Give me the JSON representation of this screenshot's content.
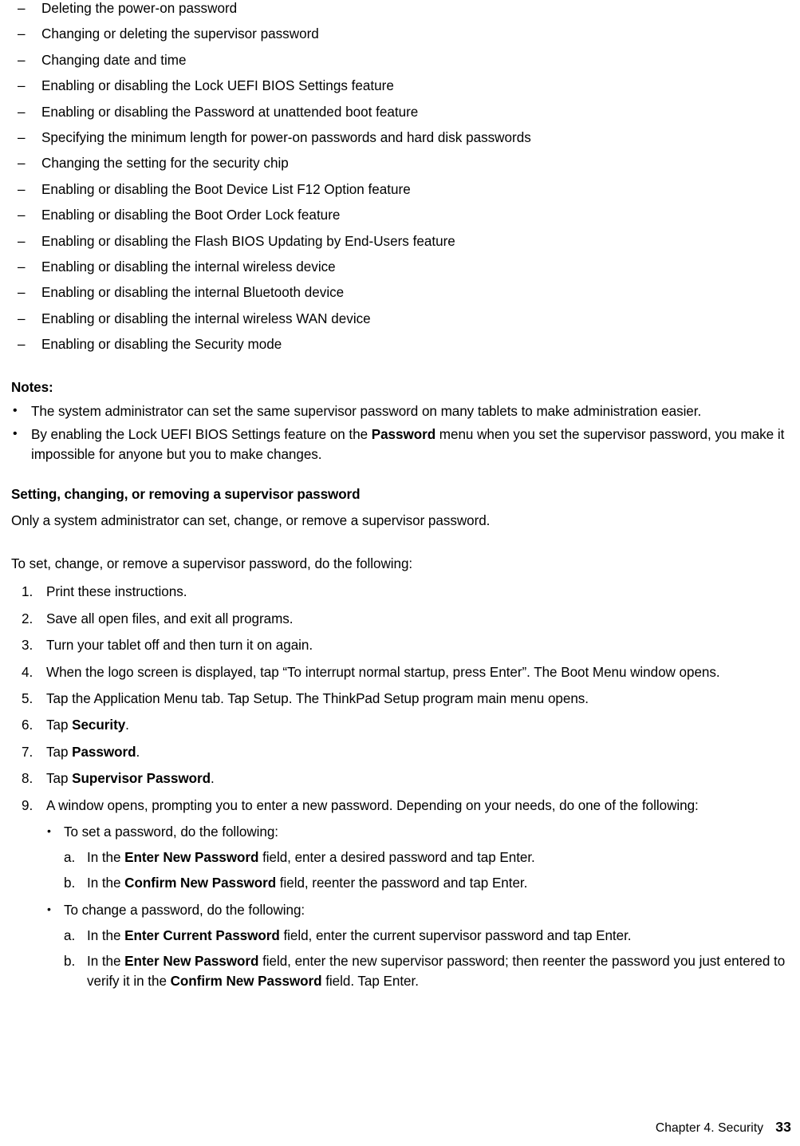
{
  "document": {
    "dash_items": [
      "Deleting the power-on password",
      "Changing or deleting the supervisor password",
      "Changing date and time",
      "Enabling or disabling the Lock UEFI BIOS Settings feature",
      "Enabling or disabling the Password at unattended boot feature",
      "Specifying the minimum length for power-on passwords and hard disk passwords",
      "Changing the setting for the security chip",
      "Enabling or disabling the Boot Device List F12 Option feature",
      "Enabling or disabling the Boot Order Lock feature",
      "Enabling or disabling the Flash BIOS Updating by End-Users feature",
      "Enabling or disabling the internal wireless device",
      "Enabling or disabling the internal Bluetooth device",
      "Enabling or disabling the internal wireless WAN device",
      "Enabling or disabling the Security mode"
    ],
    "notes_heading": "Notes:",
    "notes": [
      {
        "parts": [
          {
            "text": "The system administrator can set the same supervisor password on many tablets to make administration easier.",
            "bold": false
          }
        ]
      },
      {
        "parts": [
          {
            "text": "By enabling the Lock UEFI BIOS Settings feature on the ",
            "bold": false
          },
          {
            "text": "Password",
            "bold": true
          },
          {
            "text": " menu when you set the supervisor password, you make it impossible for anyone but you to make changes.",
            "bold": false
          }
        ]
      }
    ],
    "section_heading": "Setting, changing, or removing a supervisor password",
    "intro_paragraph": "Only a system administrator can set, change, or remove a supervisor password.",
    "procedure_lead": "To set, change, or remove a supervisor password, do the following:",
    "steps": [
      {
        "marker": "1.",
        "parts": [
          {
            "text": "Print these instructions.",
            "bold": false
          }
        ]
      },
      {
        "marker": "2.",
        "parts": [
          {
            "text": "Save all open files, and exit all programs.",
            "bold": false
          }
        ]
      },
      {
        "marker": "3.",
        "parts": [
          {
            "text": "Turn your tablet off and then turn it on again.",
            "bold": false
          }
        ]
      },
      {
        "marker": "4.",
        "parts": [
          {
            "text": "When the logo screen is displayed, tap “To interrupt normal startup, press Enter”.  The Boot Menu window opens.",
            "bold": false
          }
        ]
      },
      {
        "marker": "5.",
        "parts": [
          {
            "text": "Tap the Application Menu tab.  Tap Setup.  The ThinkPad Setup program main menu opens.",
            "bold": false
          }
        ]
      },
      {
        "marker": "6.",
        "parts": [
          {
            "text": "Tap ",
            "bold": false
          },
          {
            "text": "Security",
            "bold": true
          },
          {
            "text": ".",
            "bold": false
          }
        ]
      },
      {
        "marker": "7.",
        "parts": [
          {
            "text": "Tap ",
            "bold": false
          },
          {
            "text": "Password",
            "bold": true
          },
          {
            "text": ".",
            "bold": false
          }
        ]
      },
      {
        "marker": "8.",
        "parts": [
          {
            "text": "Tap ",
            "bold": false
          },
          {
            "text": "Supervisor Password",
            "bold": true
          },
          {
            "text": ".",
            "bold": false
          }
        ]
      },
      {
        "marker": "9.",
        "parts": [
          {
            "text": "A window opens, prompting you to enter a new password.  Depending on your needs, do one of the following:",
            "bold": false
          }
        ]
      }
    ],
    "sub_groups": [
      {
        "bullet_parts": [
          {
            "text": "To set a password, do the following:",
            "bold": false
          }
        ],
        "letters": [
          {
            "marker": "a.",
            "parts": [
              {
                "text": "In the ",
                "bold": false
              },
              {
                "text": "Enter New Password",
                "bold": true
              },
              {
                "text": " field, enter a desired password and tap Enter.",
                "bold": false
              }
            ]
          },
          {
            "marker": "b.",
            "parts": [
              {
                "text": "In the ",
                "bold": false
              },
              {
                "text": "Confirm New Password",
                "bold": true
              },
              {
                "text": " field, reenter the password and tap Enter.",
                "bold": false
              }
            ]
          }
        ]
      },
      {
        "bullet_parts": [
          {
            "text": "To change a password, do the following:",
            "bold": false
          }
        ],
        "letters": [
          {
            "marker": "a.",
            "parts": [
              {
                "text": "In the ",
                "bold": false
              },
              {
                "text": "Enter Current Password",
                "bold": true
              },
              {
                "text": " field, enter the current supervisor password and tap Enter.",
                "bold": false
              }
            ]
          },
          {
            "marker": "b.",
            "parts": [
              {
                "text": "In the ",
                "bold": false
              },
              {
                "text": "Enter New Password",
                "bold": true
              },
              {
                "text": " field, enter the new supervisor password; then reenter the password you just entered to verify it in the ",
                "bold": false
              },
              {
                "text": "Confirm New Password",
                "bold": true
              },
              {
                "text": " field.  Tap Enter.",
                "bold": false
              }
            ]
          }
        ]
      }
    ],
    "footer": {
      "chapter": "Chapter  4.  Security",
      "page_number": "33"
    },
    "icons": {
      "dash": "–",
      "bullet": "•"
    }
  }
}
